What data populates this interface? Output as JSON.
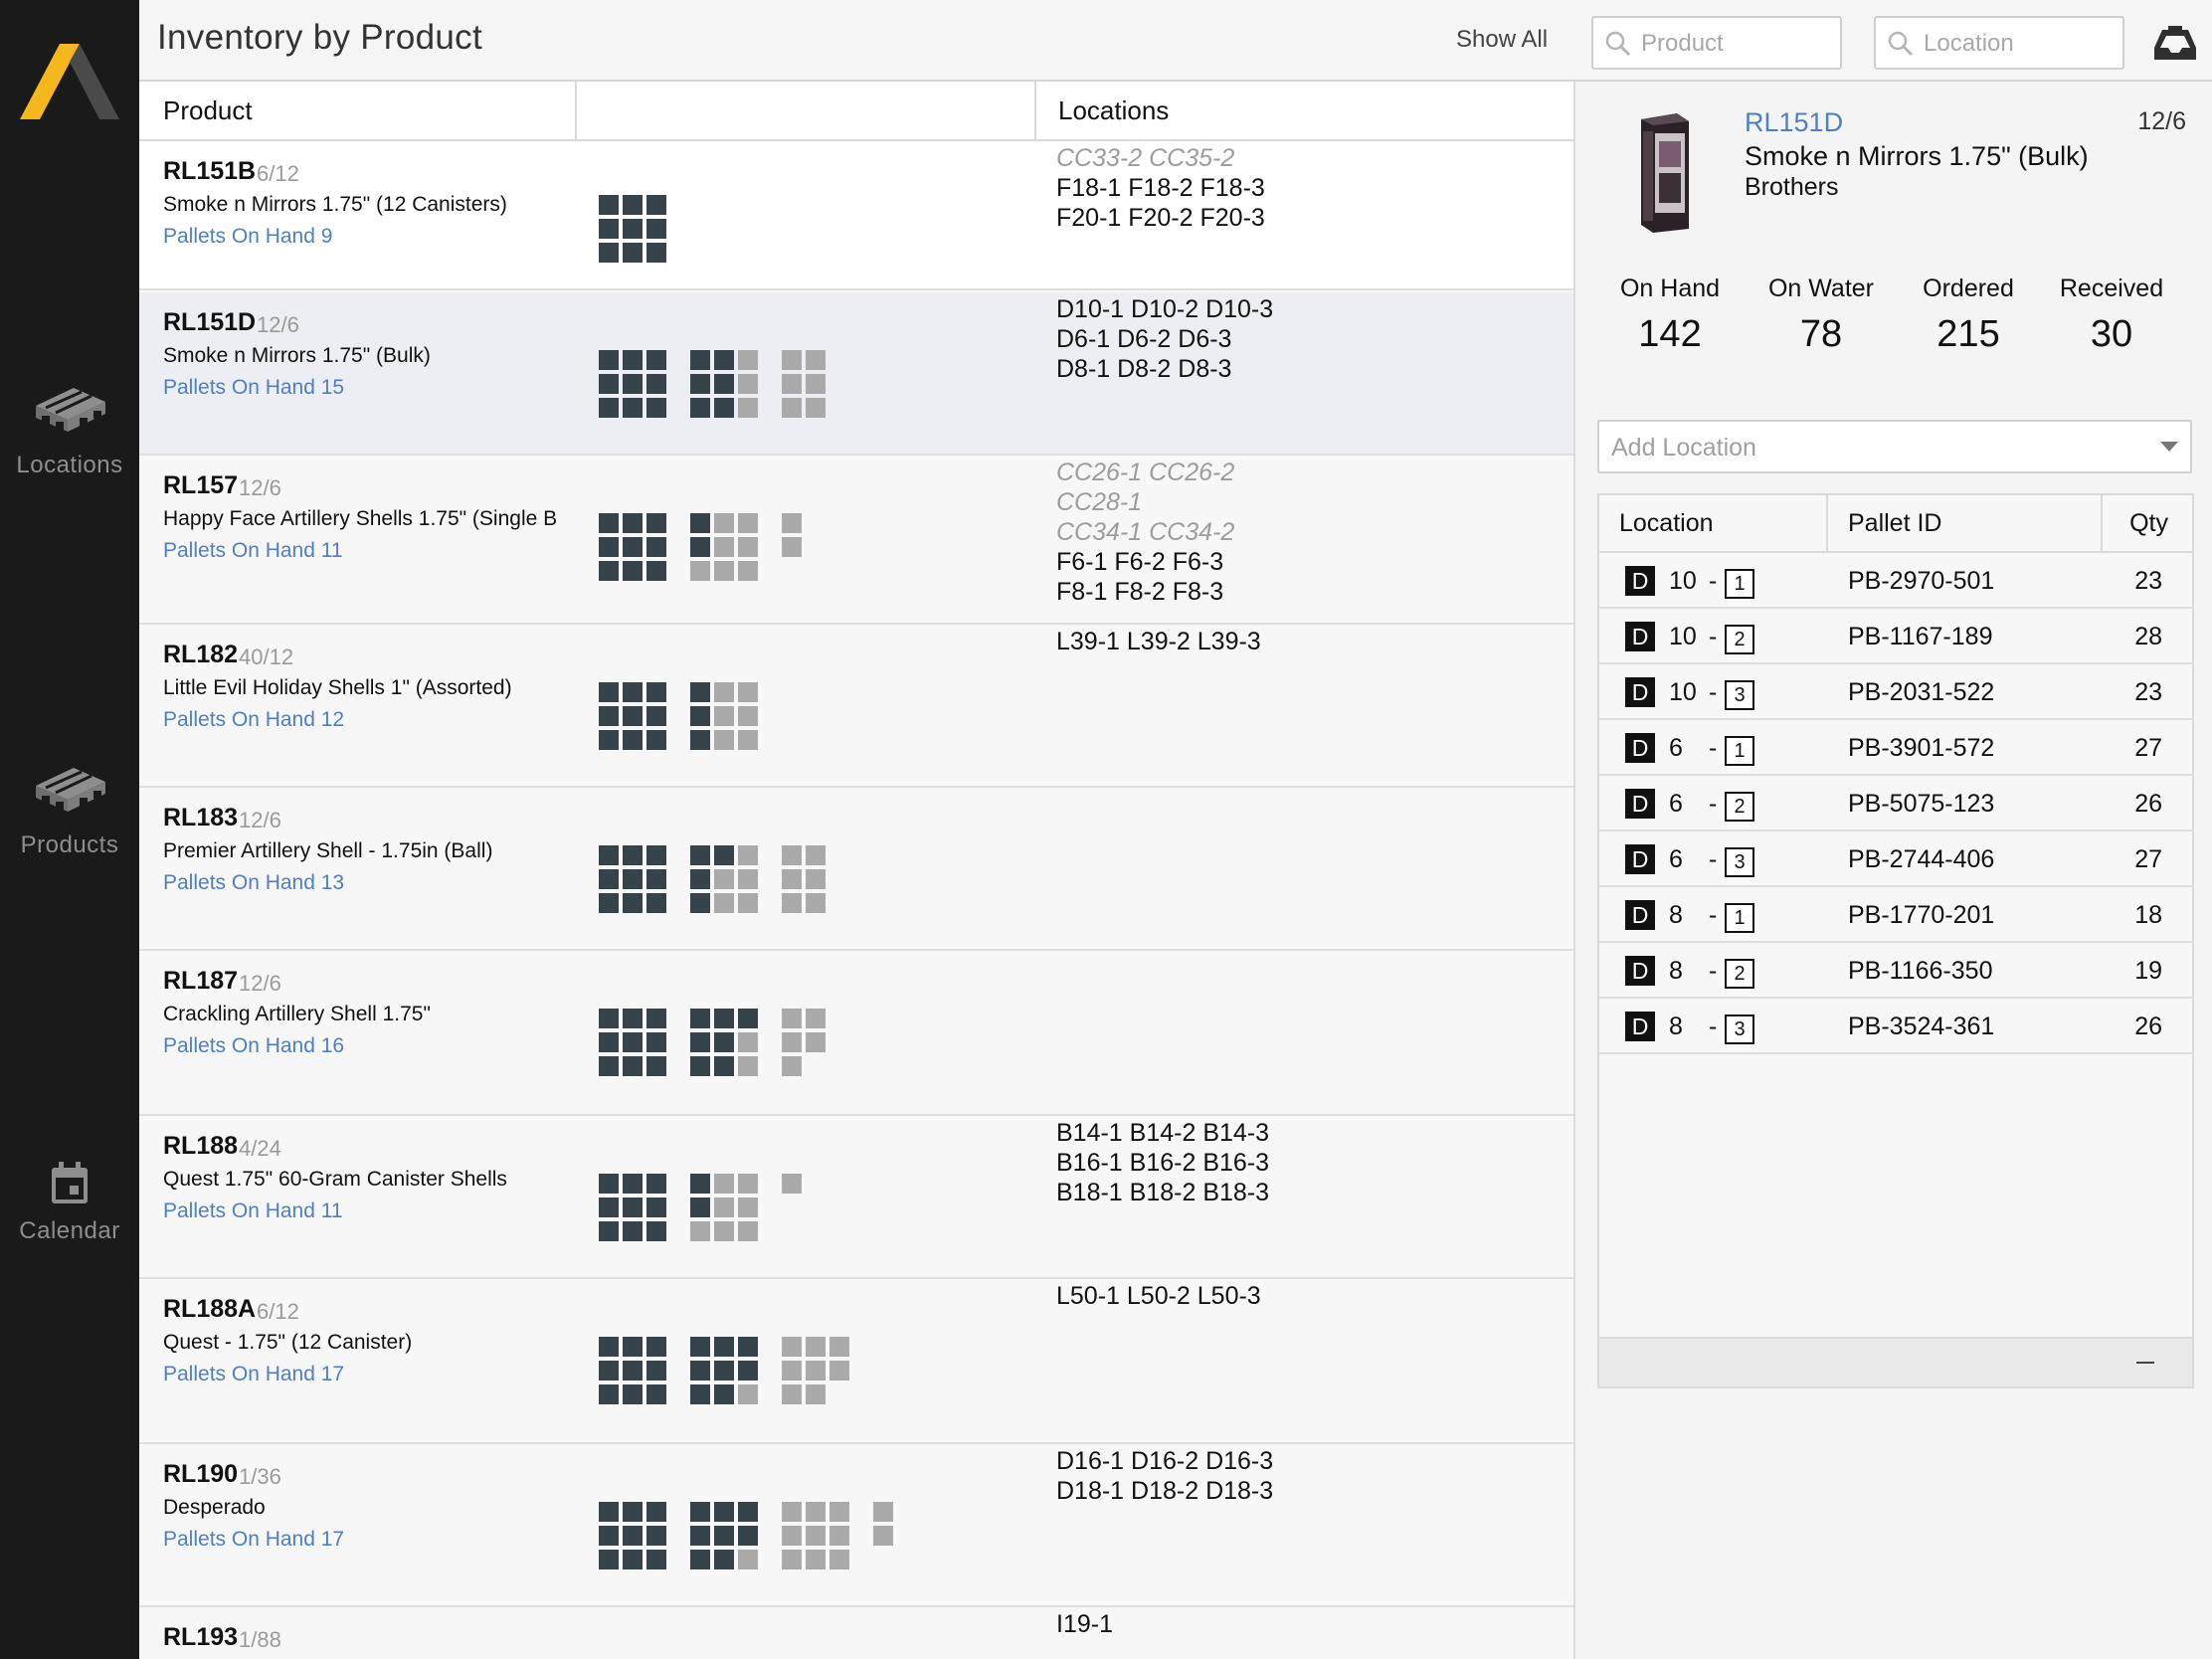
{
  "nav": {
    "items": [
      {
        "label": "Locations",
        "icon": "pallet-icon"
      },
      {
        "label": "Products",
        "icon": "pallet-icon"
      },
      {
        "label": "Calendar",
        "icon": "calendar-icon"
      }
    ]
  },
  "header": {
    "title": "Inventory by Product",
    "show_all_label": "Show All",
    "product_search_placeholder": "Product",
    "location_search_placeholder": "Location",
    "action_icon": "inbox-icon"
  },
  "list": {
    "columns": {
      "product": "Product",
      "pallets": "",
      "locations": "Locations"
    },
    "rows": [
      {
        "sku": "RL151B",
        "pack": "6/12",
        "name": "Smoke n Mirrors 1.75\" (12 Canisters)",
        "pallets": "Pallets On Hand 9",
        "locations": [
          {
            "text": "CC33-2 CC35-2",
            "temporary": true
          },
          {
            "text": "F18-1 F18-2 F18-3",
            "temporary": false
          },
          {
            "text": "F20-1 F20-2 F20-3",
            "temporary": false
          }
        ],
        "pallet_grids": [
          [
            1,
            1,
            1,
            1,
            1,
            1,
            1,
            1,
            1
          ]
        ]
      },
      {
        "sku": "RL151D",
        "pack": "12/6",
        "name": "Smoke n Mirrors 1.75\" (Bulk)",
        "pallets": "Pallets On Hand 15",
        "locations": [
          {
            "text": "D10-1 D10-2 D10-3",
            "temporary": false
          },
          {
            "text": "D6-1 D6-2 D6-3",
            "temporary": false
          },
          {
            "text": "D8-1 D8-2 D8-3",
            "temporary": false
          }
        ],
        "pallet_grids": [
          [
            1,
            1,
            1,
            1,
            1,
            1,
            1,
            1,
            1
          ],
          [
            1,
            1,
            2,
            1,
            1,
            2,
            1,
            1,
            2
          ],
          [
            2,
            2,
            0,
            2,
            2,
            0,
            2,
            2,
            0
          ]
        ]
      },
      {
        "sku": "RL157",
        "pack": "12/6",
        "name": "Happy Face Artillery Shells 1.75\" (Single B",
        "pallets": "Pallets On Hand 11",
        "locations": [
          {
            "text": "CC26-1 CC26-2",
            "temporary": true
          },
          {
            "text": "CC28-1",
            "temporary": true
          },
          {
            "text": "CC34-1 CC34-2",
            "temporary": true
          },
          {
            "text": "F6-1 F6-2 F6-3",
            "temporary": false
          },
          {
            "text": "F8-1 F8-2 F8-3",
            "temporary": false
          }
        ],
        "pallet_grids": [
          [
            1,
            1,
            1,
            1,
            1,
            1,
            1,
            1,
            1
          ],
          [
            1,
            2,
            2,
            1,
            2,
            2,
            2,
            2,
            2
          ],
          [
            2,
            0,
            0,
            2,
            0,
            0,
            0,
            0,
            0
          ]
        ]
      },
      {
        "sku": "RL182",
        "pack": "40/12",
        "name": "Little Evil Holiday Shells 1\" (Assorted)",
        "pallets": "Pallets On Hand 12",
        "locations": [
          {
            "text": "L39-1 L39-2 L39-3",
            "temporary": false
          }
        ],
        "pallet_grids": [
          [
            1,
            1,
            1,
            1,
            1,
            1,
            1,
            1,
            1
          ],
          [
            1,
            2,
            2,
            1,
            2,
            2,
            1,
            2,
            2
          ]
        ]
      },
      {
        "sku": "RL183",
        "pack": "12/6",
        "name": "Premier Artillery Shell - 1.75in (Ball)",
        "pallets": "Pallets On Hand 13",
        "locations": [],
        "pallet_grids": [
          [
            1,
            1,
            1,
            1,
            1,
            1,
            1,
            1,
            1
          ],
          [
            1,
            1,
            2,
            1,
            2,
            2,
            1,
            2,
            2
          ],
          [
            2,
            2,
            0,
            2,
            2,
            0,
            2,
            2,
            0
          ]
        ]
      },
      {
        "sku": "RL187",
        "pack": "12/6",
        "name": "Crackling Artillery Shell 1.75\"",
        "pallets": "Pallets On Hand 16",
        "locations": [],
        "pallet_grids": [
          [
            1,
            1,
            1,
            1,
            1,
            1,
            1,
            1,
            1
          ],
          [
            1,
            1,
            1,
            1,
            1,
            2,
            1,
            1,
            2
          ],
          [
            2,
            2,
            0,
            2,
            2,
            0,
            2,
            0,
            0
          ]
        ]
      },
      {
        "sku": "RL188",
        "pack": "4/24",
        "name": "Quest 1.75\" 60-Gram Canister Shells",
        "pallets": "Pallets On Hand 11",
        "locations": [
          {
            "text": "B14-1 B14-2 B14-3",
            "temporary": false
          },
          {
            "text": "B16-1 B16-2 B16-3",
            "temporary": false
          },
          {
            "text": "B18-1 B18-2 B18-3",
            "temporary": false
          }
        ],
        "pallet_grids": [
          [
            1,
            1,
            1,
            1,
            1,
            1,
            1,
            1,
            1
          ],
          [
            1,
            2,
            2,
            1,
            2,
            2,
            2,
            2,
            2
          ],
          [
            2,
            0,
            0,
            0,
            0,
            0,
            0,
            0,
            0
          ]
        ]
      },
      {
        "sku": "RL188A",
        "pack": "6/12",
        "name": "Quest - 1.75\" (12 Canister)",
        "pallets": "Pallets On Hand 17",
        "locations": [
          {
            "text": "L50-1 L50-2 L50-3",
            "temporary": false
          }
        ],
        "pallet_grids": [
          [
            1,
            1,
            1,
            1,
            1,
            1,
            1,
            1,
            1
          ],
          [
            1,
            1,
            1,
            1,
            1,
            1,
            1,
            1,
            2
          ],
          [
            2,
            2,
            2,
            2,
            2,
            2,
            2,
            2,
            0
          ]
        ]
      },
      {
        "sku": "RL190",
        "pack": "1/36",
        "name": "Desperado",
        "pallets": "Pallets On Hand 17",
        "locations": [
          {
            "text": "D16-1 D16-2 D16-3",
            "temporary": false
          },
          {
            "text": "D18-1 D18-2 D18-3",
            "temporary": false
          }
        ],
        "pallet_grids": [
          [
            1,
            1,
            1,
            1,
            1,
            1,
            1,
            1,
            1
          ],
          [
            1,
            1,
            1,
            1,
            1,
            1,
            1,
            1,
            2
          ],
          [
            2,
            2,
            2,
            2,
            2,
            2,
            2,
            2,
            2
          ],
          [
            2,
            0,
            0,
            2,
            0,
            0,
            0,
            0,
            0
          ]
        ]
      },
      {
        "sku": "RL193",
        "pack": "1/88",
        "name": "",
        "pallets": "",
        "locations": [
          {
            "text": "I19-1",
            "temporary": false
          }
        ],
        "pallet_grids": []
      }
    ]
  },
  "detail": {
    "sku": "RL151D",
    "pack": "12/6",
    "name": "Smoke n Mirrors 1.75\" (Bulk)",
    "brand": "Brothers",
    "stats": {
      "on_hand": {
        "label": "On Hand",
        "value": "142"
      },
      "on_water": {
        "label": "On Water",
        "value": "78"
      },
      "ordered": {
        "label": "Ordered",
        "value": "215"
      },
      "received": {
        "label": "Received",
        "value": "30"
      }
    },
    "add_location_placeholder": "Add Location",
    "table": {
      "headers": {
        "location": "Location",
        "pallet_id": "Pallet ID",
        "qty": "Qty"
      },
      "rows": [
        {
          "zone": "D",
          "aisle": "10",
          "sep": "-",
          "level": "1",
          "pallet_id": "PB-2970-501",
          "qty": "23"
        },
        {
          "zone": "D",
          "aisle": "10",
          "sep": "-",
          "level": "2",
          "pallet_id": "PB-1167-189",
          "qty": "28"
        },
        {
          "zone": "D",
          "aisle": "10",
          "sep": "-",
          "level": "3",
          "pallet_id": "PB-2031-522",
          "qty": "23"
        },
        {
          "zone": "D",
          "aisle": "6",
          "sep": "-",
          "level": "1",
          "pallet_id": "PB-3901-572",
          "qty": "27"
        },
        {
          "zone": "D",
          "aisle": "6",
          "sep": "-",
          "level": "2",
          "pallet_id": "PB-5075-123",
          "qty": "26"
        },
        {
          "zone": "D",
          "aisle": "6",
          "sep": "-",
          "level": "3",
          "pallet_id": "PB-2744-406",
          "qty": "27"
        },
        {
          "zone": "D",
          "aisle": "8",
          "sep": "-",
          "level": "1",
          "pallet_id": "PB-1770-201",
          "qty": "18"
        },
        {
          "zone": "D",
          "aisle": "8",
          "sep": "-",
          "level": "2",
          "pallet_id": "PB-1166-350",
          "qty": "19"
        },
        {
          "zone": "D",
          "aisle": "8",
          "sep": "-",
          "level": "3",
          "pallet_id": "PB-3524-361",
          "qty": "26"
        }
      ]
    }
  },
  "colors": {
    "nav_bg": "#1a1a1a",
    "logo_yellow": "#f5b81c",
    "link_blue": "#4f7fc0",
    "pallet_full": "#36434b",
    "pallet_partial": "#a9a9a9",
    "selected_row": "#eceef3"
  }
}
